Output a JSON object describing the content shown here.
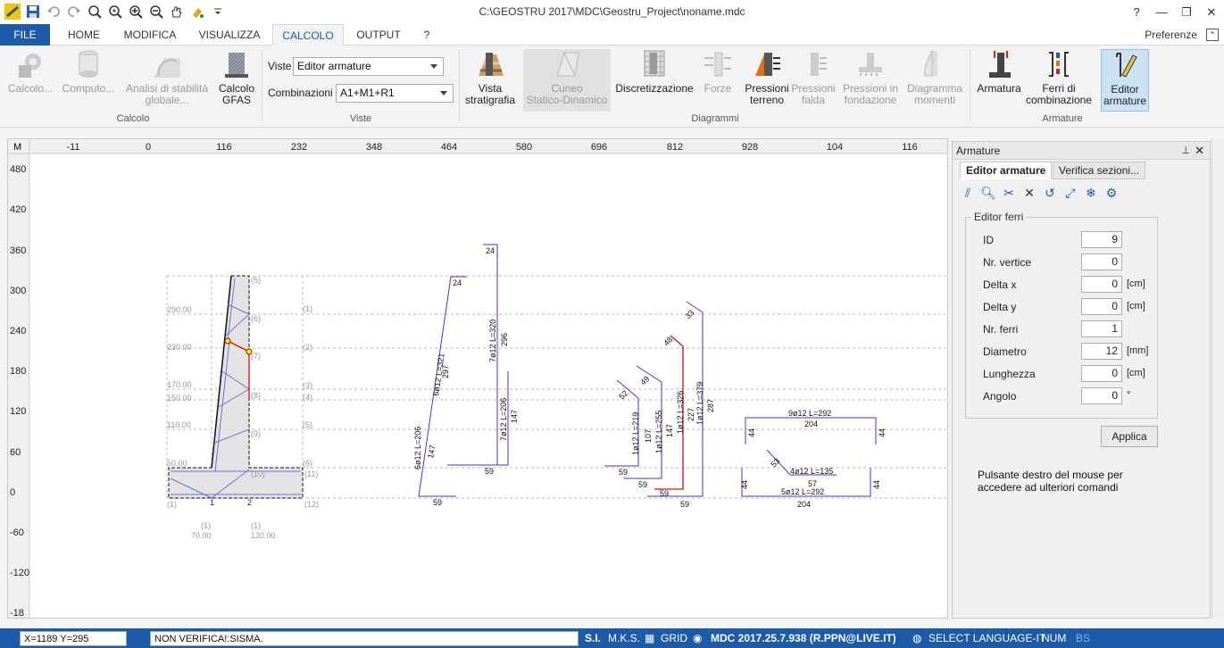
{
  "window": {
    "title": "C:\\GEOSTRU 2017\\MDC\\Geostru_Project\\noname.mdc"
  },
  "tabs": {
    "file": "FILE",
    "home": "HOME",
    "modifica": "MODIFICA",
    "visualizza": "VISUALIZZA",
    "calcolo": "CALCOLO",
    "output": "OUTPUT",
    "help": "?",
    "preferenze": "Preferenze"
  },
  "ribbon": {
    "calcolo_group": "Calcolo",
    "viste_group": "Viste",
    "diagrammi_group": "Diagrammi",
    "armature_group": "Armature",
    "btn_calcolo": "Calcolo...",
    "btn_computo": "Computo...",
    "btn_stabilita_1": "Analisi di stabilità",
    "btn_stabilita_2": "globale...",
    "btn_gfas_1": "Calcolo",
    "btn_gfas_2": "GFAS",
    "viste_label": "Viste",
    "viste_value": "Editor armature",
    "combinazioni_label": "Combinazioni",
    "combinazioni_value": "A1+M1+R1",
    "btn_vista_1": "Vista",
    "btn_vista_2": "stratigrafia",
    "btn_cuneo_1": "Cuneo",
    "btn_cuneo_2": "Statico-Dinamico",
    "btn_discretizzazione": "Discretizzazione",
    "btn_forze": "Forze",
    "btn_pressioni_terreno_1": "Pressioni",
    "btn_pressioni_terreno_2": "terreno",
    "btn_pressioni_falda_1": "Pressioni",
    "btn_pressioni_falda_2": "falda",
    "btn_pressioni_fondazione_1": "Pressioni in",
    "btn_pressioni_fondazione_2": "fondazione",
    "btn_diagramma_1": "Diagramma",
    "btn_diagramma_2": "momenti",
    "btn_armatura": "Armatura",
    "btn_ferri_1": "Ferri di",
    "btn_ferri_2": "combinazione",
    "btn_editor_1": "Editor",
    "btn_editor_2": "armature"
  },
  "canvas": {
    "corner_label": "M",
    "x_ticks": [
      "-11",
      "0",
      "116",
      "232",
      "348",
      "464",
      "580",
      "696",
      "812",
      "928",
      "104",
      "116"
    ],
    "y_ticks": [
      "480",
      "420",
      "360",
      "300",
      "240",
      "180",
      "120",
      "60",
      "0",
      "-60",
      "-120",
      "-18"
    ],
    "level_labels": [
      "290.00",
      "230.00",
      "170.00",
      "150.00",
      "110.00",
      "50.00"
    ],
    "node_labels": [
      "(5)",
      "(6)",
      "(7)",
      "(8)",
      "(9)",
      "(10)",
      "(11)",
      "(12)",
      "(1)",
      "(2)",
      "(3)",
      "(4)",
      "(5)",
      "(6)",
      "(1)",
      "1",
      "2"
    ],
    "bottom_labels": [
      "(1)",
      "70.00",
      "(1)",
      "130.00"
    ],
    "bar_labels": {
      "b24a": "24",
      "b297": "297",
      "b6o12_321": "6ø12 L=321",
      "b147a": "147",
      "b6o12_206": "6ø12 L=206",
      "b59a": "59",
      "b24b": "24",
      "b7o12_320": "7ø12 L=320",
      "b296": "296",
      "b7o12_206": "7ø12 L=206",
      "b147b": "147",
      "b59b": "59",
      "b52": "52",
      "b1o12_219": "1ø12 L=219",
      "b59c": "59",
      "b49": "49",
      "b107": "107",
      "b1o12_255": "1ø12 L=255",
      "b59d": "59",
      "b48": "48",
      "b147c": "147",
      "b1o12_326": "1ø12 L=326",
      "b227": "227",
      "b59e": "59",
      "b33": "33",
      "b1o12_379": "1ø12 L=379",
      "b287": "287",
      "b59f": "59",
      "b9o12_292": "9ø12 L=292",
      "b204a": "204",
      "b44a": "44",
      "b44b": "44",
      "b53": "53",
      "b4o12_135": "4ø12 L=135",
      "b57": "57",
      "b44c": "44",
      "b44d": "44",
      "b5o12_292": "5ø12 L=292",
      "b204b": "204"
    }
  },
  "panel": {
    "title": "Armature",
    "tab_editor": "Editor armature",
    "tab_verifica": "Verifica sezioni...",
    "fieldset_title": "Editor ferri",
    "fields": [
      {
        "label": "ID",
        "value": "9",
        "unit": ""
      },
      {
        "label": "Nr. vertice",
        "value": "0",
        "unit": ""
      },
      {
        "label": "Delta x",
        "value": "0",
        "unit": "[cm]"
      },
      {
        "label": "Delta y",
        "value": "0",
        "unit": "[cm]"
      },
      {
        "label": "Nr. ferri",
        "value": "1",
        "unit": ""
      },
      {
        "label": "Diametro",
        "value": "12",
        "unit": "[mm]"
      },
      {
        "label": "Lunghezza",
        "value": "0",
        "unit": "[cm]"
      },
      {
        "label": "Angolo",
        "value": "0",
        "unit": "°"
      }
    ],
    "apply": "Applica",
    "hint": "Pulsante destro del mouse per accedere ad ulteriori comandi"
  },
  "status": {
    "coords": "X=1189  Y=295",
    "message": "NON VERIFICA!:SISMA.",
    "si": "S.I.",
    "mks": "M.K.S.",
    "grid": "GRID",
    "version": "MDC  2017.25.7.938 (R.PPN@LIVE.IT)",
    "language": "SELECT LANGUAGE-IT",
    "num": "NUM",
    "bs": "BS"
  },
  "colors": {
    "accent": "#1d5aa8",
    "rebar": "#3a3ad8",
    "rebar_selected": "#d01010"
  }
}
